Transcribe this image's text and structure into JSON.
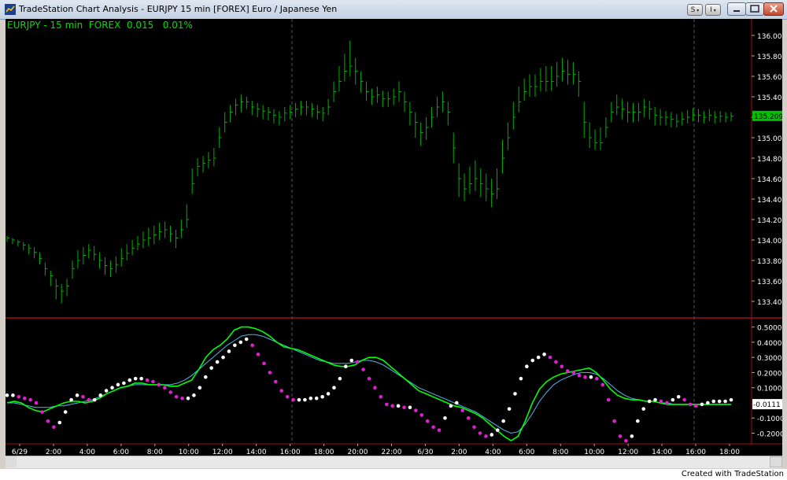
{
  "window": {
    "title": "TradeStation Chart Analysis - EURJPY 15 min [FOREX] Euro / Japanese Yen",
    "status_text": "Created with TradeStation",
    "buttons": {
      "s": "S",
      "i": "I"
    }
  },
  "symbol": {
    "label": "EURJPY - 15 min  FOREX  0.015   0.01%",
    "last_price": "135.209",
    "osc_value": "-0.0111"
  },
  "colors": {
    "price_bar": "#00b000",
    "fast_line": "#00ff00",
    "slow_line": "#4fb6e8",
    "dot_up": "#ffffff",
    "dot_down": "#e020d0",
    "dot_cross_up": "#00e0e0",
    "dot_cross_dn": "#ffff00",
    "divider": "#a01010"
  },
  "chart_data": [
    {
      "type": "bar",
      "title": "EURJPY - 15 min",
      "ylim": [
        133.3,
        136.1
      ],
      "y_ticks": [
        "136.000",
        "135.800",
        "135.600",
        "135.400",
        "135.200",
        "135.000",
        "134.800",
        "134.600",
        "134.400",
        "134.200",
        "134.000",
        "133.800",
        "133.600",
        "133.400"
      ],
      "values": [
        134.02,
        134.0,
        133.98,
        133.95,
        133.92,
        133.88,
        133.82,
        133.72,
        133.65,
        133.55,
        133.5,
        133.55,
        133.72,
        133.8,
        133.85,
        133.9,
        133.86,
        133.8,
        133.75,
        133.72,
        133.76,
        133.82,
        133.87,
        133.92,
        133.96,
        134.0,
        134.02,
        134.05,
        134.08,
        134.1,
        134.06,
        134.02,
        134.1,
        134.2,
        134.55,
        134.72,
        134.75,
        134.78,
        134.8,
        135.0,
        135.15,
        135.25,
        135.32,
        135.35,
        135.35,
        135.3,
        135.28,
        135.26,
        135.25,
        135.22,
        135.2,
        135.24,
        135.25,
        135.28,
        135.3,
        135.3,
        135.28,
        135.25,
        135.24,
        135.3,
        135.45,
        135.55,
        135.65,
        135.7,
        135.65,
        135.55,
        135.45,
        135.4,
        135.42,
        135.38,
        135.38,
        135.4,
        135.45,
        135.35,
        135.25,
        135.15,
        135.05,
        135.1,
        135.2,
        135.3,
        135.35,
        135.25,
        134.9,
        134.6,
        134.5,
        134.55,
        134.6,
        134.55,
        134.5,
        134.45,
        134.5,
        134.8,
        135.0,
        135.2,
        135.35,
        135.45,
        135.5,
        135.5,
        135.55,
        135.55,
        135.55,
        135.6,
        135.65,
        135.62,
        135.62,
        135.55,
        135.15,
        135.0,
        134.95,
        134.95,
        135.1,
        135.25,
        135.3,
        135.28,
        135.25,
        135.25,
        135.25,
        135.3,
        135.28,
        135.22,
        135.2,
        135.2,
        135.18,
        135.16,
        135.18,
        135.2,
        135.22,
        135.22,
        135.2,
        135.22,
        135.2,
        135.21,
        135.2,
        135.21
      ],
      "highs": [
        134.04,
        134.02,
        134.0,
        133.98,
        133.96,
        133.93,
        133.88,
        133.78,
        133.7,
        133.62,
        133.57,
        133.62,
        133.8,
        133.9,
        133.93,
        133.96,
        133.94,
        133.88,
        133.83,
        133.8,
        133.84,
        133.92,
        133.96,
        134.0,
        134.04,
        134.08,
        134.12,
        134.14,
        134.17,
        134.18,
        134.14,
        134.1,
        134.2,
        134.35,
        134.7,
        134.8,
        134.82,
        134.86,
        134.9,
        135.1,
        135.25,
        135.32,
        135.38,
        135.42,
        135.4,
        135.36,
        135.34,
        135.32,
        135.3,
        135.28,
        135.26,
        135.3,
        135.32,
        135.34,
        135.36,
        135.36,
        135.34,
        135.32,
        135.3,
        135.38,
        135.55,
        135.7,
        135.82,
        135.95,
        135.78,
        135.65,
        135.55,
        135.48,
        135.5,
        135.46,
        135.45,
        135.48,
        135.55,
        135.45,
        135.35,
        135.25,
        135.15,
        135.2,
        135.3,
        135.4,
        135.45,
        135.35,
        135.05,
        134.75,
        134.65,
        134.72,
        134.78,
        134.7,
        134.65,
        134.6,
        134.7,
        134.98,
        135.15,
        135.35,
        135.5,
        135.58,
        135.62,
        135.62,
        135.68,
        135.7,
        135.7,
        135.74,
        135.78,
        135.76,
        135.74,
        135.65,
        135.35,
        135.15,
        135.08,
        135.1,
        135.2,
        135.35,
        135.42,
        135.38,
        135.35,
        135.34,
        135.34,
        135.38,
        135.36,
        135.3,
        135.28,
        135.26,
        135.25,
        135.23,
        135.25,
        135.27,
        135.29,
        135.28,
        135.26,
        135.28,
        135.26,
        135.26,
        135.25,
        135.25
      ],
      "lows": [
        133.98,
        133.96,
        133.94,
        133.9,
        133.86,
        133.82,
        133.76,
        133.65,
        133.55,
        133.42,
        133.38,
        133.45,
        133.62,
        133.72,
        133.76,
        133.82,
        133.8,
        133.72,
        133.66,
        133.64,
        133.68,
        133.74,
        133.8,
        133.85,
        133.9,
        133.92,
        133.94,
        133.96,
        134.0,
        134.02,
        133.98,
        133.92,
        134.02,
        134.12,
        134.45,
        134.62,
        134.66,
        134.7,
        134.72,
        134.9,
        135.05,
        135.15,
        135.22,
        135.25,
        135.28,
        135.22,
        135.2,
        135.18,
        135.17,
        135.14,
        135.12,
        135.16,
        135.18,
        135.2,
        135.22,
        135.22,
        135.2,
        135.18,
        135.16,
        135.22,
        135.35,
        135.45,
        135.55,
        135.6,
        135.52,
        135.44,
        135.36,
        135.32,
        135.34,
        135.3,
        135.3,
        135.32,
        135.35,
        135.25,
        135.12,
        135.0,
        134.92,
        134.98,
        135.1,
        135.2,
        135.25,
        135.12,
        134.75,
        134.42,
        134.38,
        134.45,
        134.48,
        134.42,
        134.38,
        134.32,
        134.4,
        134.65,
        134.88,
        135.08,
        135.25,
        135.36,
        135.4,
        135.4,
        135.45,
        135.45,
        135.46,
        135.5,
        135.55,
        135.52,
        135.52,
        135.4,
        135.0,
        134.9,
        134.88,
        134.88,
        135.0,
        135.15,
        135.22,
        135.18,
        135.15,
        135.15,
        135.16,
        135.2,
        135.18,
        135.12,
        135.12,
        135.12,
        135.1,
        135.1,
        135.12,
        135.14,
        135.16,
        135.15,
        135.14,
        135.16,
        135.14,
        135.15,
        135.15,
        135.16
      ]
    },
    {
      "type": "line",
      "title": "",
      "ylim": [
        -0.27,
        0.55
      ],
      "y_ticks": [
        "0.5000",
        "0.4000",
        "0.3000",
        "0.2000",
        "0.1000",
        "-0.1000",
        "-0.2000"
      ],
      "x_tick_labels": [
        "6/29",
        "2:00",
        "4:00",
        "6:00",
        "8:00",
        "10:00",
        "12:00",
        "14:00",
        "16:00",
        "18:00",
        "20:00",
        "22:00",
        "6/30",
        "2:00",
        "4:00",
        "6:00",
        "8:00",
        "10:00",
        "12:00",
        "14:00",
        "16:00",
        "18:00"
      ],
      "series": [
        {
          "values": [
            0.0,
            0.01,
            0.0,
            -0.03,
            -0.05,
            -0.06,
            -0.04,
            -0.02,
            0.0,
            0.01,
            0.01,
            0.0,
            0.01,
            0.03,
            0.06,
            0.08,
            0.1,
            0.11,
            0.13,
            0.13,
            0.12,
            0.12,
            0.12,
            0.11,
            0.11,
            0.13,
            0.15,
            0.22,
            0.3,
            0.35,
            0.38,
            0.42,
            0.48,
            0.5,
            0.5,
            0.49,
            0.47,
            0.44,
            0.4,
            0.37,
            0.36,
            0.35,
            0.33,
            0.31,
            0.29,
            0.27,
            0.25,
            0.24,
            0.24,
            0.25,
            0.28,
            0.3,
            0.3,
            0.28,
            0.24,
            0.2,
            0.16,
            0.12,
            0.08,
            0.06,
            0.04,
            0.02,
            0.0,
            -0.02,
            -0.03,
            -0.05,
            -0.07,
            -0.1,
            -0.14,
            -0.18,
            -0.22,
            -0.25,
            -0.22,
            -0.12,
            0.0,
            0.09,
            0.14,
            0.17,
            0.19,
            0.2,
            0.21,
            0.22,
            0.23,
            0.2,
            0.15,
            0.09,
            0.05,
            0.03,
            0.02,
            0.02,
            0.01,
            0.01,
            0.0,
            -0.01,
            -0.01,
            -0.01,
            -0.01,
            -0.01,
            -0.01,
            -0.01,
            -0.01,
            -0.01,
            -0.01
          ]
        },
        {
          "values": [
            0.0,
            0.0,
            -0.01,
            -0.02,
            -0.03,
            -0.03,
            -0.03,
            -0.02,
            -0.02,
            -0.01,
            0.0,
            0.01,
            0.02,
            0.04,
            0.06,
            0.08,
            0.1,
            0.11,
            0.12,
            0.12,
            0.12,
            0.12,
            0.12,
            0.12,
            0.13,
            0.15,
            0.18,
            0.22,
            0.26,
            0.3,
            0.34,
            0.38,
            0.41,
            0.44,
            0.45,
            0.45,
            0.44,
            0.42,
            0.4,
            0.38,
            0.36,
            0.34,
            0.32,
            0.3,
            0.28,
            0.27,
            0.26,
            0.26,
            0.26,
            0.27,
            0.28,
            0.28,
            0.27,
            0.25,
            0.22,
            0.19,
            0.16,
            0.13,
            0.1,
            0.08,
            0.06,
            0.04,
            0.02,
            0.0,
            -0.02,
            -0.04,
            -0.06,
            -0.09,
            -0.12,
            -0.15,
            -0.18,
            -0.2,
            -0.19,
            -0.14,
            -0.07,
            0.01,
            0.07,
            0.12,
            0.15,
            0.17,
            0.19,
            0.2,
            0.2,
            0.19,
            0.16,
            0.12,
            0.08,
            0.05,
            0.03,
            0.02,
            0.01,
            0.01,
            0.0,
            0.0,
            -0.01,
            -0.01,
            -0.01,
            -0.01,
            -0.01,
            -0.01,
            -0.01,
            -0.01,
            -0.01
          ]
        },
        {
          "values": [
            0.05,
            0.05,
            0.04,
            0.03,
            0.02,
            0.0,
            -0.06,
            -0.12,
            -0.16,
            -0.13,
            -0.06,
            0.02,
            0.05,
            0.04,
            0.02,
            0.02,
            0.05,
            0.08,
            0.1,
            0.12,
            0.13,
            0.15,
            0.16,
            0.16,
            0.15,
            0.14,
            0.12,
            0.1,
            0.07,
            0.04,
            0.03,
            0.03,
            0.05,
            0.1,
            0.17,
            0.23,
            0.27,
            0.3,
            0.34,
            0.38,
            0.4,
            0.42,
            0.38,
            0.32,
            0.26,
            0.2,
            0.14,
            0.08,
            0.04,
            0.02,
            0.02,
            0.02,
            0.03,
            0.03,
            0.04,
            0.06,
            0.1,
            0.16,
            0.24,
            0.28,
            0.27,
            0.22,
            0.16,
            0.1,
            0.04,
            -0.01,
            -0.02,
            -0.02,
            -0.03,
            -0.03,
            -0.05,
            -0.08,
            -0.12,
            -0.16,
            -0.18,
            -0.1,
            -0.02,
            0.0,
            -0.05,
            -0.1,
            -0.16,
            -0.2,
            -0.22,
            -0.21,
            -0.18,
            -0.12,
            -0.04,
            0.06,
            0.16,
            0.24,
            0.28,
            0.3,
            0.32,
            0.3,
            0.27,
            0.24,
            0.21,
            0.2,
            0.18,
            0.17,
            0.17,
            0.16,
            0.12,
            0.02,
            -0.12,
            -0.22,
            -0.25,
            -0.22,
            -0.12,
            -0.04,
            0.01,
            0.02,
            0.01,
            0.0,
            0.02,
            0.04,
            0.02,
            -0.01,
            -0.02,
            -0.01,
            0.0,
            0.01,
            0.01,
            0.01,
            0.02
          ]
        }
      ]
    }
  ]
}
